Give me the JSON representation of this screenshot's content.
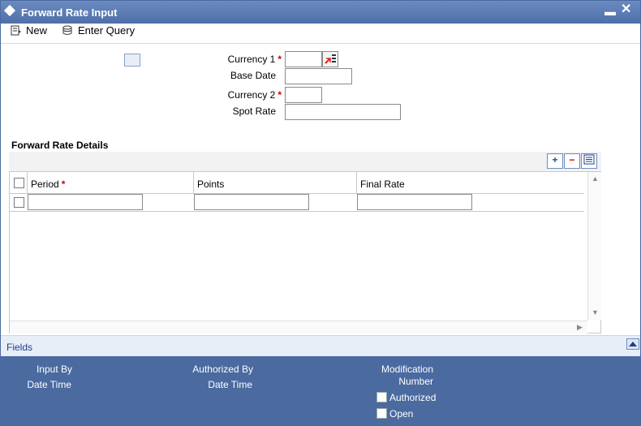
{
  "window": {
    "title": "Forward Rate Input"
  },
  "toolbar": {
    "new_label": "New",
    "enter_query_label": "Enter Query"
  },
  "form": {
    "currency1_label": "Currency 1",
    "base_date_label": "Base Date",
    "currency2_label": "Currency 2",
    "spot_rate_label": "Spot Rate",
    "required_mark": "*"
  },
  "details": {
    "section_title": "Forward Rate Details",
    "columns": [
      "Period",
      "Points",
      "Final Rate"
    ],
    "add_label": "+",
    "remove_label": "−"
  },
  "fields_bar": {
    "label": "Fields"
  },
  "footer": {
    "input_by": "Input By",
    "input_date_time": "Date Time",
    "authorized_by": "Authorized By",
    "authorized_date_time": "Date Time",
    "modification": "Modification",
    "number": "Number",
    "authorized_checkbox": "Authorized",
    "open_checkbox": "Open"
  }
}
